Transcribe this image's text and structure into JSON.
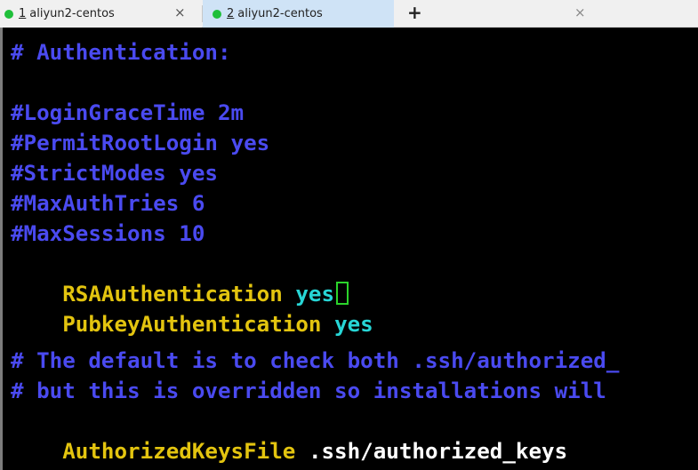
{
  "tabs": [
    {
      "number": "1",
      "title": "aliyun2-centos",
      "close": "×"
    },
    {
      "number": "2",
      "title": "aliyun2-centos",
      "close": "×"
    }
  ],
  "new_tab": "+",
  "terminal": {
    "lines": {
      "auth_header": "# Authentication:",
      "login_grace": "#LoginGraceTime 2m",
      "permit_root": "#PermitRootLogin yes",
      "strict_modes": "#StrictModes yes",
      "max_auth": "#MaxAuthTries 6",
      "max_sessions": "#MaxSessions 10",
      "rsa_key": "RSAAuthentication",
      "rsa_val": "yes",
      "pubkey_key": "PubkeyAuthentication",
      "pubkey_val": "yes",
      "comment_default": "# The default is to check both .ssh/authorized_",
      "comment_override": "# but this is overridden so installations will",
      "auth_keys_key": "AuthorizedKeysFile",
      "auth_keys_val": ".ssh/authorized_keys"
    }
  },
  "colors": {
    "comment": "#4a4af0",
    "keyword": "#e3c40f",
    "value": "#27d6d6",
    "cursor": "#2bd42b",
    "tab_active": "#cfe3f6",
    "status_dot": "#1fbf3a"
  }
}
